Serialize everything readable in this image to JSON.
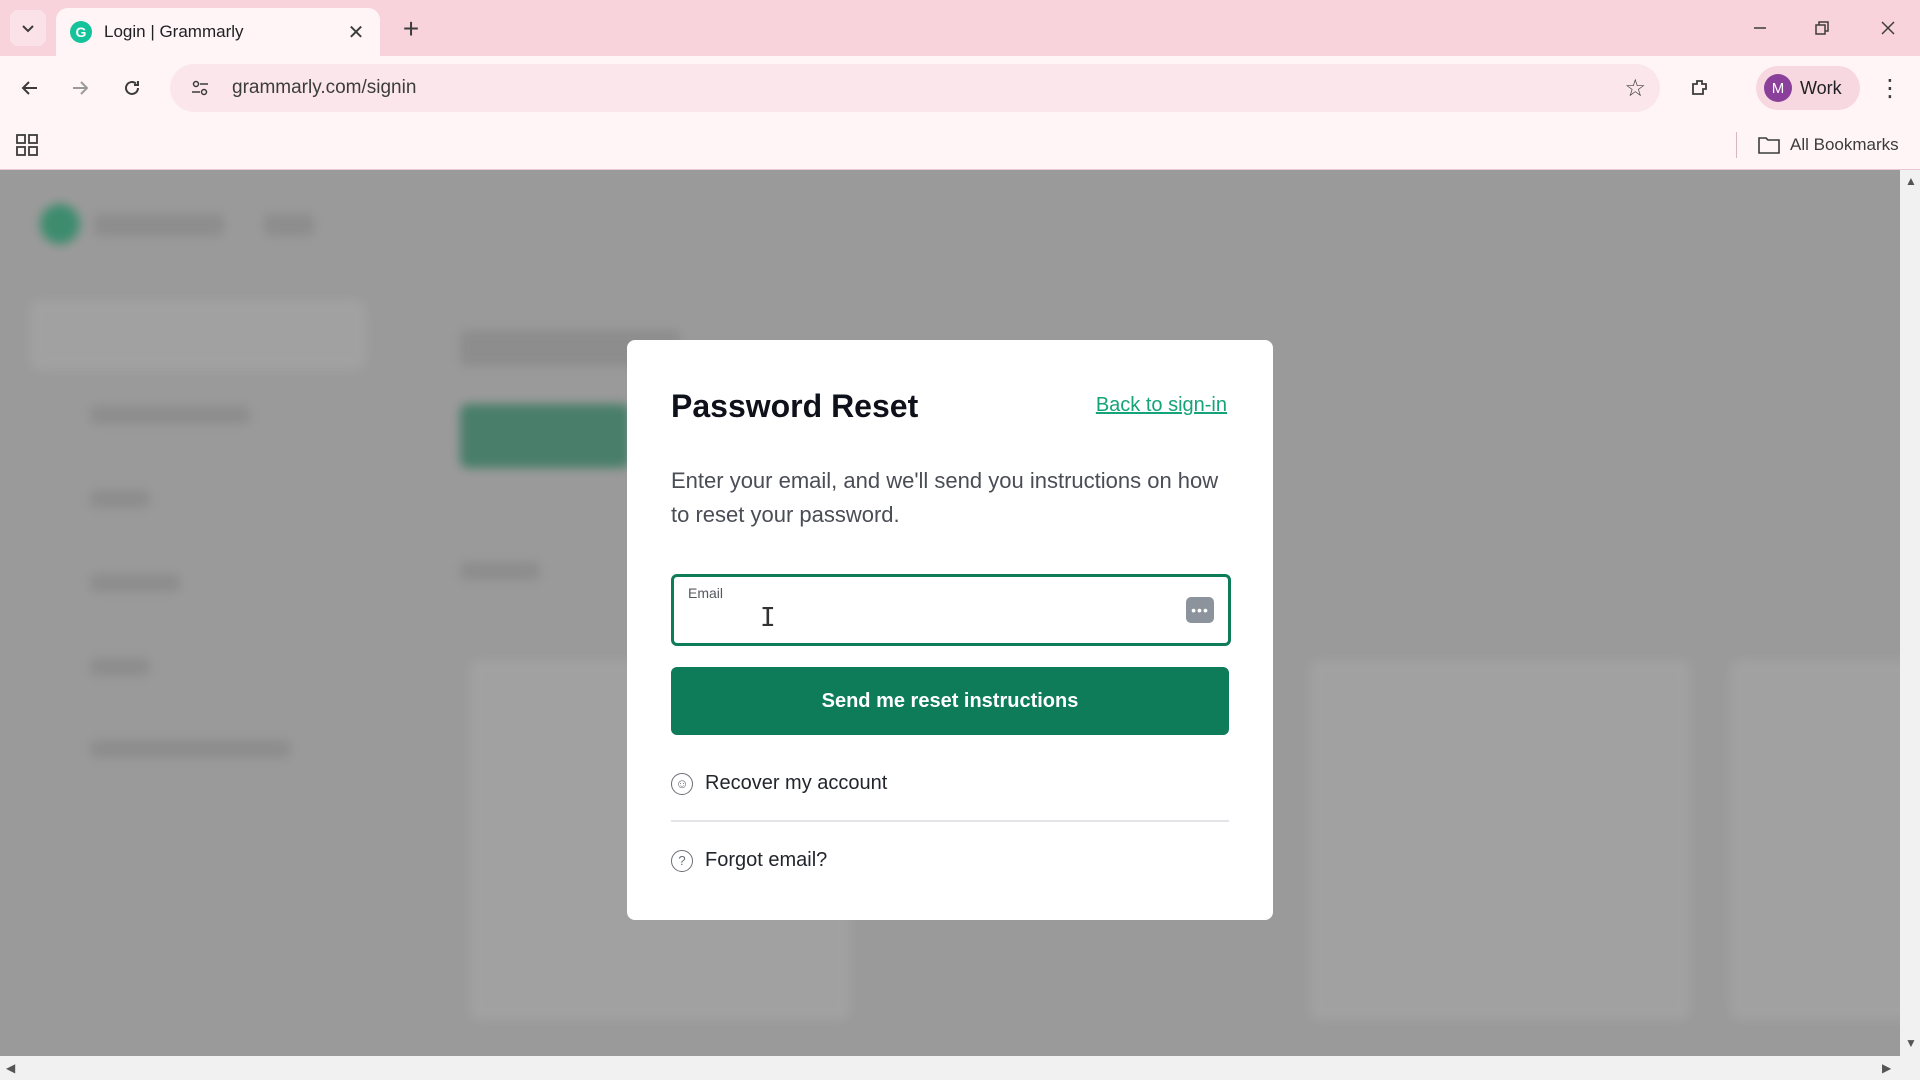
{
  "browser": {
    "tab_title": "Login | Grammarly",
    "url": "grammarly.com/signin",
    "profile_initial": "M",
    "profile_name": "Work",
    "all_bookmarks": "All Bookmarks"
  },
  "modal": {
    "title": "Password Reset",
    "back_link": "Back to sign-in",
    "description": "Enter your email, and we'll send you instructions on how to reset your password.",
    "email_label": "Email",
    "email_value": "",
    "submit_label": "Send me reset instructions",
    "recover_label": "Recover my account",
    "forgot_label": "Forgot email?"
  },
  "colors": {
    "accent": "#0e7c59",
    "link": "#15a37a",
    "tabstrip": "#f9d3dc"
  }
}
